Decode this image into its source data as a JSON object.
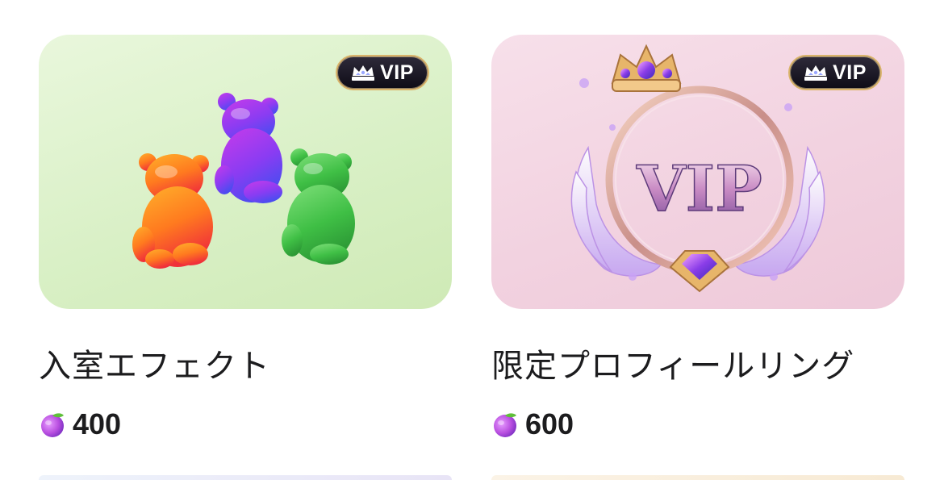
{
  "items": [
    {
      "badge_label": "VIP",
      "title": "入室エフェクト",
      "price": "400",
      "currency_icon": "plum-coin-icon",
      "image": "gummy-bears-icon",
      "background": "#dbf0c9"
    },
    {
      "badge_label": "VIP",
      "title": "限定プロフィールリング",
      "price": "600",
      "currency_icon": "plum-coin-icon",
      "image": "vip-profile-ring-icon",
      "background": "#f2d3e1"
    }
  ],
  "colors": {
    "badge_bg": "#1a1722",
    "badge_border": "#d9b36a",
    "text": "#1c1c1e",
    "coin_purple": "#b94fe0",
    "coin_leaf": "#5fbf3a"
  }
}
